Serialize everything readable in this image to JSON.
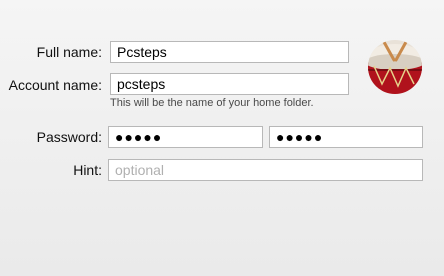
{
  "form": {
    "full_name": {
      "label": "Full name:",
      "value": "Pcsteps"
    },
    "account_name": {
      "label": "Account name:",
      "value": "pcsteps",
      "help": "This will be the name of your home folder."
    },
    "password": {
      "label": "Password:",
      "value": "●●●●●",
      "verify_value": "●●●●●"
    },
    "hint": {
      "label": "Hint:",
      "placeholder": "optional"
    }
  },
  "avatar": {
    "icon": "drum-avatar",
    "colors": {
      "drum": "#b0121c",
      "skin": "#f2ece3"
    }
  }
}
